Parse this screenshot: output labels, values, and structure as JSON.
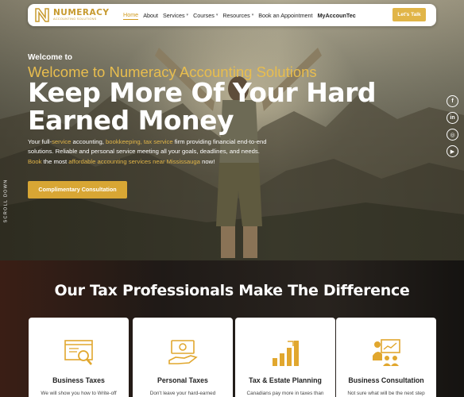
{
  "nav": {
    "logo_name": "NUMERACY",
    "logo_sub": "ACCOUNTING SOLUTIONS",
    "items": [
      {
        "label": "Home",
        "active": true,
        "caret": false
      },
      {
        "label": "About",
        "active": false,
        "caret": false
      },
      {
        "label": "Services",
        "active": false,
        "caret": true
      },
      {
        "label": "Courses",
        "active": false,
        "caret": true
      },
      {
        "label": "Resources",
        "active": false,
        "caret": true
      },
      {
        "label": "Book an Appointment",
        "active": false,
        "caret": false
      },
      {
        "label": "MyAccounTec",
        "active": false,
        "caret": false
      }
    ],
    "cta": "Let's Talk"
  },
  "hero": {
    "welcome_small": "Welcome to",
    "welcome_big": "Welcome to Numeracy Accounting Solutions",
    "headline": "Keep More Of Your Hard Earned Money",
    "para_1": "Your full-",
    "para_2": "service",
    "para_3": " accounting, ",
    "para_4": "bookkeeping, tax service",
    "para_5": " firm providing financial end-to-end solutions. Reliable and personal service meeting all your goals, deadlines, and needs. ",
    "para_6": "Book",
    "para_7": " the most ",
    "para_8": "affordable accounting services near Mississauga",
    "para_9": " now!",
    "button": "Complimentary Consultation",
    "scroll_label": "SCROLL DOWN"
  },
  "social": [
    {
      "icon": "facebook-icon",
      "glyph": "f"
    },
    {
      "icon": "linkedin-icon",
      "glyph": "in"
    },
    {
      "icon": "instagram-icon",
      "glyph": "◎"
    },
    {
      "icon": "youtube-icon",
      "glyph": "▶"
    }
  ],
  "section": {
    "title": "Our Tax Professionals Make The Difference",
    "cards": [
      {
        "title": "Business Taxes",
        "desc": "We will show you how to Write-off",
        "icon": "magnifier-document-icon"
      },
      {
        "title": "Personal Taxes",
        "desc": "Don't leave your hard-earned",
        "icon": "money-hand-icon"
      },
      {
        "title": "Tax & Estate Planning",
        "desc": "Canadians pay more in taxes than",
        "icon": "growth-chart-icon"
      },
      {
        "title": "Business Consultation",
        "desc": "Not sure what will be the next step",
        "icon": "presentation-icon"
      }
    ]
  },
  "colors": {
    "accent": "#d8a634",
    "accent_light": "#e8bd4e",
    "white": "#ffffff"
  }
}
